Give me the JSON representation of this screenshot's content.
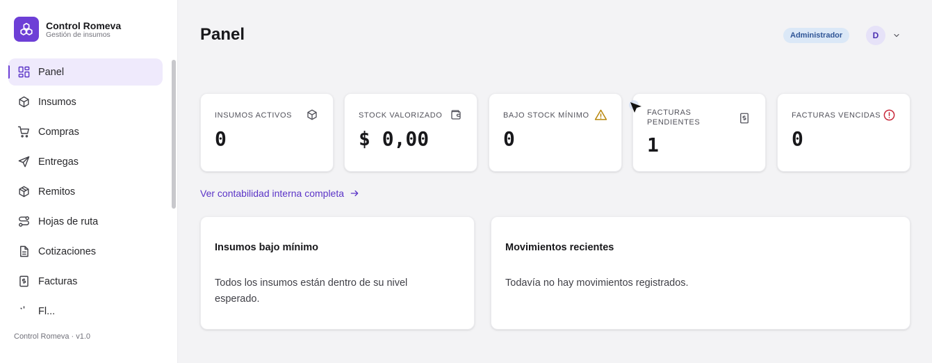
{
  "brand": {
    "title": "Control Romeva",
    "subtitle": "Gestión de insumos",
    "color": "#6d3fd6"
  },
  "sidebar": {
    "items": [
      {
        "label": "Panel",
        "icon": "grid-icon",
        "active": true
      },
      {
        "label": "Insumos",
        "icon": "box-icon"
      },
      {
        "label": "Compras",
        "icon": "cart-icon"
      },
      {
        "label": "Entregas",
        "icon": "send-icon"
      },
      {
        "label": "Remitos",
        "icon": "package-icon"
      },
      {
        "label": "Hojas de ruta",
        "icon": "route-icon"
      },
      {
        "label": "Cotizaciones",
        "icon": "document-icon"
      },
      {
        "label": "Facturas",
        "icon": "invoice-icon"
      },
      {
        "label": "Fl...",
        "icon": "partial-icon"
      }
    ],
    "version": "Control Romeva · v1.0"
  },
  "header": {
    "title": "Panel",
    "role": "Administrador",
    "avatar_initial": "D"
  },
  "stats": [
    {
      "label": "INSUMOS ACTIVOS",
      "value": "0",
      "icon": "box-icon"
    },
    {
      "label": "STOCK VALORIZADO",
      "value": "$ 0,00",
      "icon": "wallet-icon"
    },
    {
      "label": "BAJO STOCK MÍNIMO",
      "value": "0",
      "icon": "warning-icon",
      "icon_color": "#b8860b"
    },
    {
      "label": "FACTURAS PENDIENTES",
      "value": "1",
      "icon": "invoice-icon"
    },
    {
      "label": "FACTURAS VENCIDAS",
      "value": "0",
      "icon": "alert-circle-icon",
      "icon_color": "#c8283a"
    }
  ],
  "link": {
    "label": "Ver contabilidad interna completa"
  },
  "panels": {
    "low_stock": {
      "title": "Insumos bajo mínimo",
      "body_line1": "Todos los insumos están dentro de su nivel",
      "body_line2": "esperado."
    },
    "movements": {
      "title": "Movimientos recientes",
      "body": "Todavía no hay movimientos registrados."
    }
  }
}
